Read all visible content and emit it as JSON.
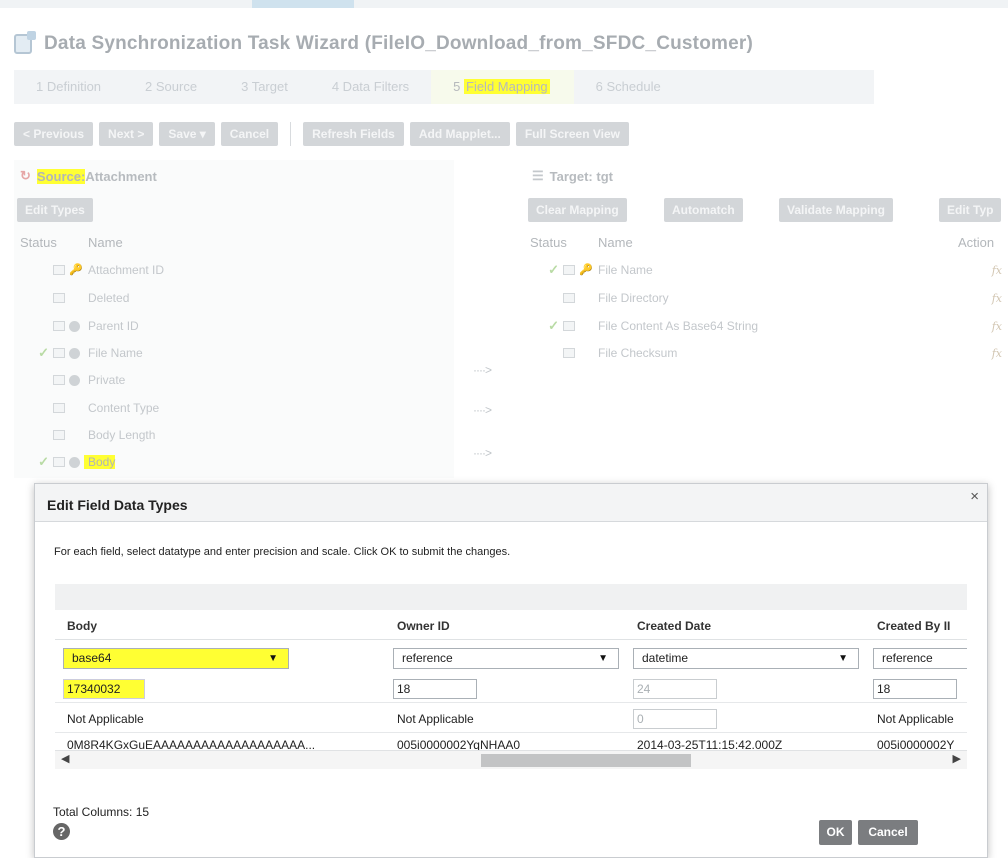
{
  "wizard": {
    "title": "Data Synchronization Task Wizard (FileIO_Download_from_SFDC_Customer)",
    "steps": [
      "1 Definition",
      "2 Source",
      "3 Target",
      "4 Data Filters",
      "5 Field Mapping",
      "6 Schedule"
    ],
    "active_step": "5 Field Mapping"
  },
  "toolbar": {
    "previous": "< Previous",
    "next": "Next >",
    "save": "Save ▾",
    "cancel": "Cancel",
    "refresh_fields": "Refresh Fields",
    "add_mapplet": "Add Mapplet...",
    "full_screen": "Full Screen View"
  },
  "source": {
    "label": "Source:",
    "name": "Attachment",
    "edit_types": "Edit Types",
    "col_status": "Status",
    "col_name": "Name",
    "fields": [
      "Attachment ID",
      "Deleted",
      "Parent ID",
      "File Name",
      "Private",
      "Content Type",
      "Body Length",
      "Body"
    ]
  },
  "target": {
    "label": "Target: tgt",
    "clear_mapping": "Clear Mapping",
    "automatch": "Automatch",
    "validate_mapping": "Validate Mapping",
    "edit_types": "Edit Typ",
    "col_status": "Status",
    "col_name": "Name",
    "col_actions": "Action",
    "fields": [
      "File Name",
      "File Directory",
      "File Content As Base64 String",
      "File Checksum"
    ],
    "fx": "fx"
  },
  "arrows": "····>",
  "modal": {
    "title": "Edit Field Data Types",
    "close": "×",
    "instructions": "For each field, select datatype and enter precision and scale. Click OK to submit the changes.",
    "columns": [
      "Body",
      "Owner ID",
      "Created Date",
      "Created By II"
    ],
    "types": [
      "base64",
      "reference",
      "datetime",
      "reference"
    ],
    "precision": [
      "17340032",
      "18",
      "24",
      "18"
    ],
    "scale": [
      "Not Applicable",
      "Not Applicable",
      "0",
      "Not Applicable"
    ],
    "sample": [
      "0M8R4KGxGuEAAAAAAAAAAAAAAAAAAA...",
      "005i0000002YqNHAA0",
      "2014-03-25T11:15:42.000Z",
      "005i0000002Y"
    ],
    "total_columns": "Total Columns: 15",
    "help": "?",
    "ok": "OK",
    "cancel": "Cancel"
  }
}
